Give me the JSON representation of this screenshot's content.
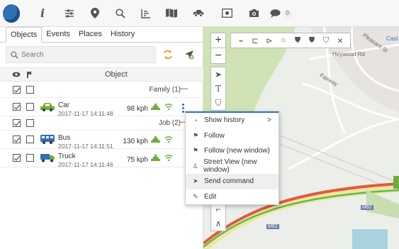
{
  "topbar": {
    "icons": [
      "logo-icon",
      "info-icon",
      "sliders-icon",
      "map-pin-icon",
      "search-icon",
      "report-icon",
      "map-book-icon",
      "vehicle-icon",
      "camera-dashboard-icon",
      "photo-camera-icon",
      "chat-icon"
    ],
    "chat_count": "0"
  },
  "tabs": [
    "Objects",
    "Events",
    "Places",
    "History"
  ],
  "search": {
    "placeholder": "Search"
  },
  "grid": {
    "header_object": "Object"
  },
  "groups": [
    {
      "label": "Family (1)",
      "collapse": "—"
    },
    {
      "label": "Job (2)",
      "collapse": "—"
    }
  ],
  "objects": [
    {
      "name": "Car",
      "time": "2017-11-17 14:11:48",
      "speed": "98 kph",
      "vehicle_color": "#6cae3c"
    },
    {
      "name": "Bus",
      "time": "2017-11-17 14:11:51",
      "speed": "130 kph",
      "vehicle_color": "#2f6fb6"
    },
    {
      "name": "Truck",
      "time": "2017-11-17 14:11:46",
      "speed": "75 kph",
      "vehicle_color": "#2f6fb6"
    }
  ],
  "context_menu": {
    "items": [
      {
        "label": "Show history",
        "has_submenu": true
      },
      {
        "label": "Follow"
      },
      {
        "label": "Follow (new window)"
      },
      {
        "label": "Street View (new window)"
      },
      {
        "label": "Send command"
      },
      {
        "label": "Edit"
      }
    ],
    "submenu_arrow": ">"
  },
  "map": {
    "labels": [
      "Heywood Rd",
      "Pleasant St",
      "Fairway",
      "Cast",
      "M62",
      "M62"
    ],
    "zoom_in": "+",
    "zoom_out": "−",
    "close": "×"
  },
  "colors": {
    "accent": "#2f6fb6",
    "online": "#6cae3c",
    "route_red": "#d9352c",
    "route_green": "#5cb85c"
  }
}
